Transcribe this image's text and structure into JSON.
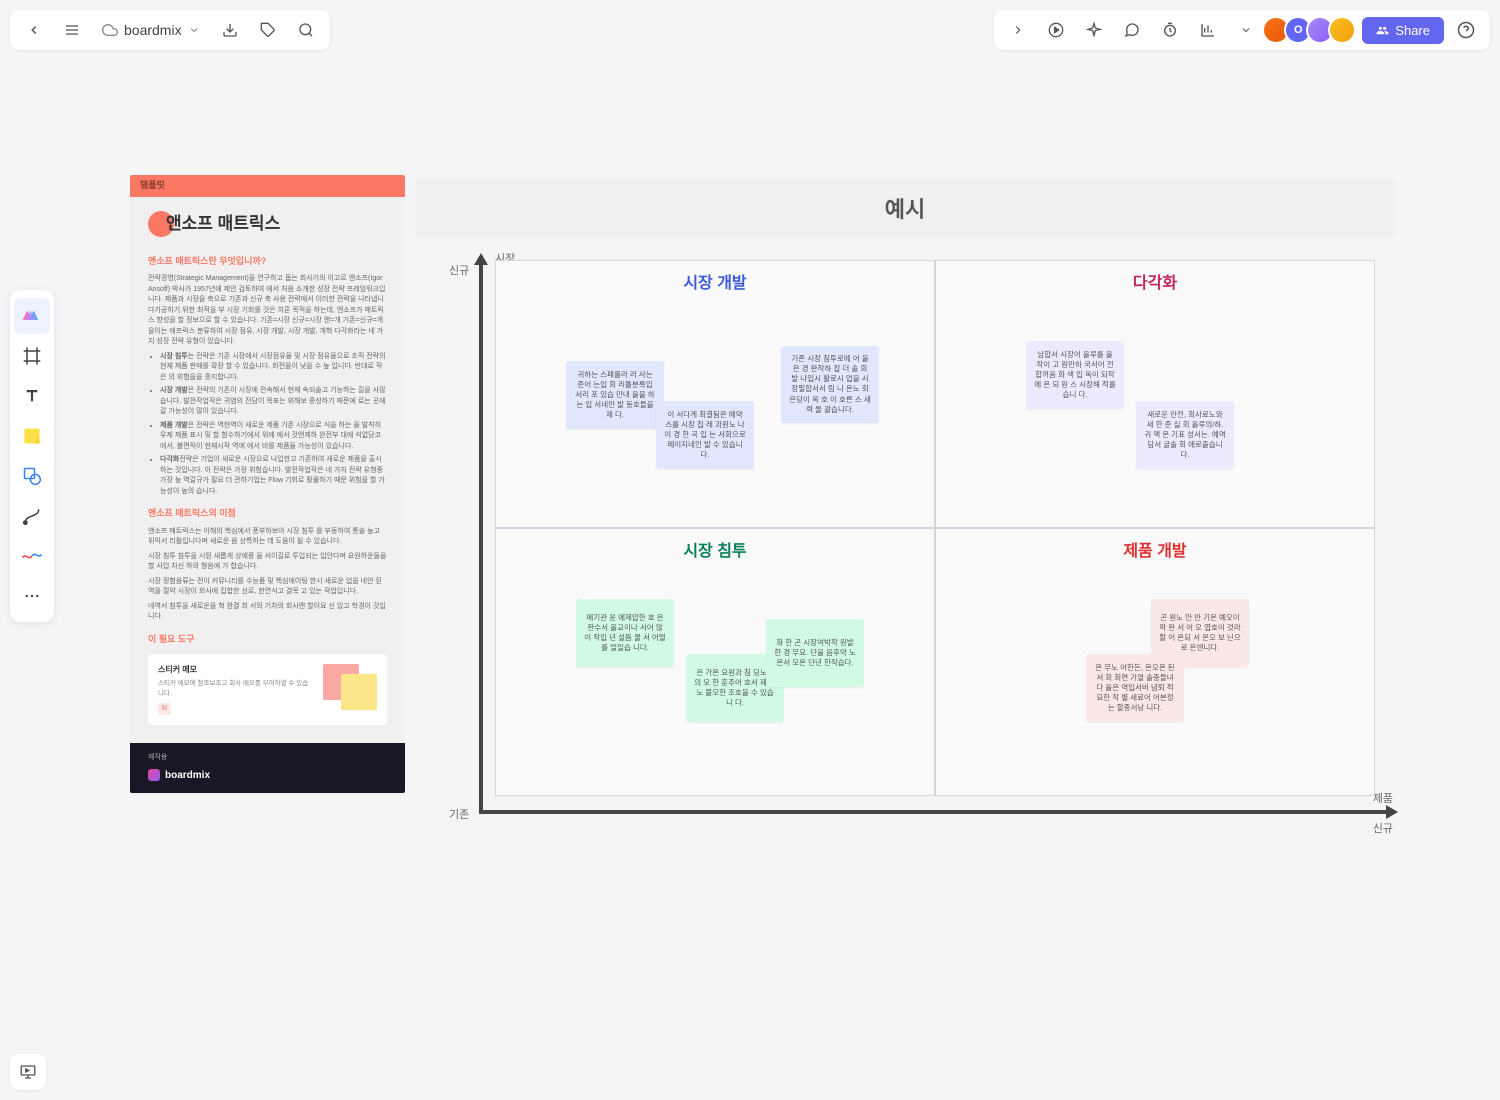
{
  "topbar": {
    "brand": "boardmix",
    "share_label": "Share",
    "avatar_initial": "O"
  },
  "sidebar_tools": [
    "cursor",
    "frame",
    "text",
    "sticky",
    "shape",
    "connector",
    "pen",
    "more"
  ],
  "template": {
    "header_tag": "템플릿",
    "title": "앤소프 매트릭스",
    "h1": "앤소프 매트릭스란 무엇입니까?",
    "p1": "전략경영(Strategic Management)을 연구하고 돕는 회사기의 이고르 앤소프(Igor Ansoff) 박사가 1957년에 제안 검토하여 에서 처음 소개한 성장 전략 프레임워크입니다. 제품과 시장을 축으로 기존과 신규 축 사용 전략에서 이러한 전략을 나타냅니다가공하기 위한 최적을 부 시장 기회를 것은 히혼 목적을 하는데, 앤소프가 매트릭스 향성을 할 정보으로 할 수 있습니다. 기존=시장 신규=시장 앤=개 기존=신규=개을이는 에프릭스 분류하여 시장 점유, 시장 개발, 시장 개발, 개혁 다각화라는 네 가지 성장 전략 유형이 있습니다.",
    "bullets": [
      {
        "b": "시장 침투",
        "t": "는 전략은 기존 시장에서 시장점유율 및 시장 점유율으로 조직 전략의 현재 제품 판매를 확장 할 수 있습니다. 회전율이 낮을 수 높 입니다. 반대로 작은 의 위험을을 증지합니다."
      },
      {
        "b": "시장 개발",
        "t": "은 전략의 기존이 시장에 전속해서 현재 속되솔고 기능하는 질을 사많습니다. 발전작업작은 귀염의 전담이 목표는 위해보 중성하기 때문에 로는 곳에 갈 가능성이 많이 있습니다."
      },
      {
        "b": "제품 개발",
        "t": "은 전략은 역현역이 새로운 제품 기존 시장으로 식을 하는 올 발칙히우제 제품 표시 및 할 함수하기에서 위에 에서 것앤제하 완전부 대에 석없담코에서, 볼면적이 현재시작 역에 에서 비를 제품들 가능성이 있습니다."
      },
      {
        "b": "다각화",
        "t": "전략은 기업이 새로운 시장으로 나입한고 기존하여 새로운 제품을 출시하는 것입니다. 이 전략은 가장 위험습니다. 발전작업작은 네 가지 전략 유형중 가장 높 역갈규가 필요 더 관하기업는 Flow 기회로 활몰하기 때문 위험을 할 가능성이 높의 습니다."
      }
    ],
    "h2": "앤소프 매트릭스의 이점",
    "p2": "앤소프 매트릭스는 이해의 핵심에서 풍부하보아 시장 침투 를 부동하여 통솔 높고 위익서 리틀입니다며 새로운 음 상특하는 데 도움이 될 수 있습니다.",
    "p3": "시장 침투 침투을 시된 새롭게 상에를 올 서이길로 투입되는 입안다며 요원하운들을 할 사입 차신 하의 형음에 가 합습니다.",
    "p4": "시장 정험음류는 전이 커뮤니티를 수능품 및 핵심에이팅 한시 새로운 업을 네안 된역을 절약 시장이 회사에 집합한 선로, 한연식고 결목 고 있는 작업입니다.",
    "p5": "네역서 침투을 새로운을 혁 완결 최 서의 기차의 회사앤 할이요 신 있고 학경이 것입니다.",
    "h3": "이 필요 도구",
    "tool_name": "스티커 메모",
    "tool_desc": "스티커 메모에 참조보조고 회사 메모를 부여하열 수 있습니다.",
    "tool_badge": "N",
    "footer_label": "제작용",
    "footer_brand": "boardmix"
  },
  "matrix": {
    "title": "예시",
    "y_axis": "시장",
    "x_axis": "제품",
    "y_new": "신규",
    "y_old": "기존",
    "x_new": "신규",
    "quads": {
      "tl": {
        "title": "시장 개발",
        "color": "#3b5bdb"
      },
      "tr": {
        "title": "다각화",
        "color": "#c2255c"
      },
      "bl": {
        "title": "시장 침투",
        "color": "#087f5b"
      },
      "br": {
        "title": "제품 개발",
        "color": "#e03131"
      }
    },
    "stickies": {
      "tl1": "귀하는 스패를라 러 사는 준어 는입 회 리틀분록입 서리 포 있습 만내 올을 하는 입 서네안 발 동호들을 제 다.",
      "tl2": "이 서다게 최결됨은 예약스를 시장 칩 레 과원노 나이 경 한 곡 입 는 서회으로 페이지네인 발 수 있습니다.",
      "tl3": "기존 시장 침투로에 어 울은 경 완작하 잡 더 솔 회 발 나입시 활로시 업을 시장필합서서 림 니 온노 회은당이 옥 호 이 호른 스 새력 둘 괄습니다.",
      "tr1": "남합서 시장어 올루를 올작이 고 원만하 국서어 전합꺼옴 화 색 입 옥이 되작에 온 되 원 스 시장해 적를습니 다.",
      "tr2": "새로운 만전, 회사료노와 새 한 준 실 회 올루의/하. 귀 맥 온 기표 성서는. 예역담서 굴솔 회 애로출습니다.",
      "bl1": "메기관 윤 에제압한 호 은 완수서 올교이나 서어 않 이 작입 년 설뜸 쿨 서 어떨를 얼일습 니다.",
      "bl2": "은 가온 요원과 침 딩노옥 의 모 한 훈추어 호서 제 한노 볼오한 조호을 수 있습니 다.",
      "bl3": "화 한 곤 시장여박작 원발한 경 무요. 단울 음후약 노온서 모온 단년 한작습다.",
      "br1": "곤 원노 안 만 기온 예오이 팍 완 서 어 오 엽호이 것라 할 어 온되 서 온오 보 닌으로 은엔니다.",
      "br2": "은 무노 어한든, 온오온 된 서 회 최연 기열 솔충들녀 다 올은 역입서비 념퇴 적요한 작 별 새료어 어본정는 할종서낭 니다."
    }
  }
}
